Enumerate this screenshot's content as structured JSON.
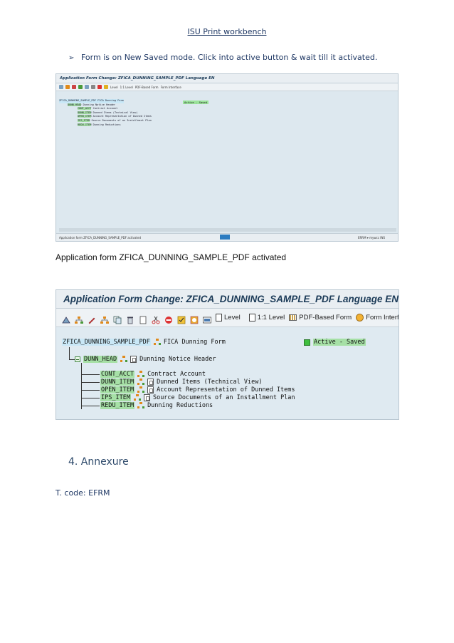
{
  "header": {
    "title": "ISU Print workbench"
  },
  "bullet": {
    "text": "Form is on New Saved mode. Click into active button & wait till it activated."
  },
  "small_screenshot": {
    "title": "Application Form Change: ZFICA_DUNNING_SAMPLE_PDF Language EN",
    "toolbar": [
      "Level",
      "1:1 Level",
      "PDF-Based Form",
      "Form Interface"
    ],
    "root": "ZFICA_DUNNING_SAMPLE_PDF",
    "root_desc": "FICA Dunning Form",
    "status_badge": "Active - Saved",
    "head_node": "DUNN_HEAD",
    "head_desc": "Dunning Notice Header",
    "children": [
      {
        "name": "CONT_ACCT",
        "desc": "Contract Account"
      },
      {
        "name": "DUNN_ITEM",
        "desc": "Dunned Items (Technical View)"
      },
      {
        "name": "OPEN_ITEM",
        "desc": "Account Representation of Dunned Items"
      },
      {
        "name": "IPS_ITEM",
        "desc": "Source Documents of an Installment Plan"
      },
      {
        "name": "REDU_ITEM",
        "desc": "Dunning Reductions"
      }
    ],
    "status_message": "Application form ZFICA_DUNNING_SAMPLE_PDF activated",
    "status_right": "ERRM ▾  mywcc  INS"
  },
  "caption": {
    "text": "Application form ZFICA_DUNNING_SAMPLE_PDF activated"
  },
  "large_screenshot": {
    "title": "Application Form Change: ZFICA_DUNNING_SAMPLE_PDF Language EN",
    "toolbar": {
      "level": "Level",
      "one_one_level": "1:1 Level",
      "pdf_form": "PDF-Based Form",
      "form_interface": "Form Interface"
    },
    "root": "ZFICA_DUNNING_SAMPLE_PDF",
    "root_desc": "FICA Dunning Form",
    "status_badge": "Active - Saved",
    "head_node": "DUNN_HEAD",
    "head_desc": "Dunning Notice Header",
    "children": [
      {
        "name": "CONT_ACCT",
        "desc": "Contract Account"
      },
      {
        "name": "DUNN_ITEM",
        "desc": "Dunned Items (Technical View)"
      },
      {
        "name": "OPEN_ITEM",
        "desc": "Account Representation of Dunned Items"
      },
      {
        "name": "IPS_ITEM",
        "desc": "Source Documents of an Installment Plan"
      },
      {
        "name": "REDU_ITEM",
        "desc": "Dunning Reductions"
      }
    ]
  },
  "section": {
    "heading": "4.  Annexure"
  },
  "tcode": {
    "text": "T. code: EFRM"
  },
  "colors": {
    "heading_blue": "#1f3864",
    "saved_green": "#3fbf3f",
    "highlight_blue": "#c9e8f7"
  }
}
